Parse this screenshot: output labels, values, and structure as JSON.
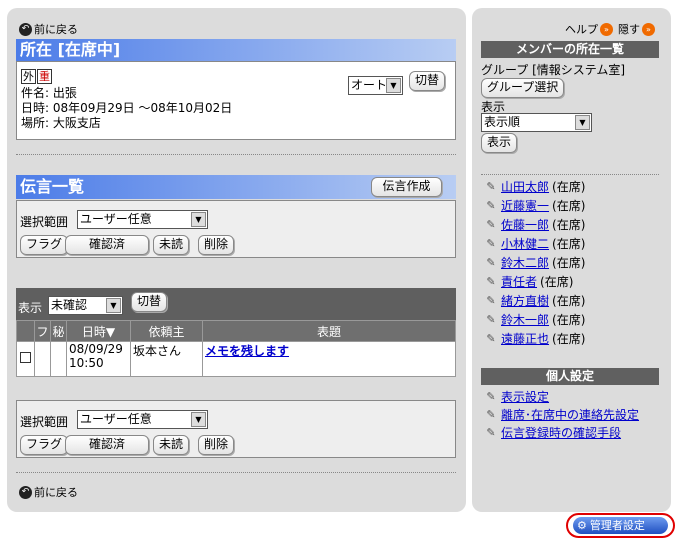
{
  "back_link": "前に戻る",
  "status": {
    "title": "所在 [在席中]",
    "tag_out": "外",
    "tag_heavy": "重",
    "mode_select": "オート",
    "switch_button": "切替",
    "subject": "件名: 出張",
    "datetime": "日時: 08年09月29日 ～08年10月02日",
    "place": "場所: 大阪支店"
  },
  "messages": {
    "title": "伝言一覧",
    "create_button": "伝言作成",
    "range_label": "選択範囲",
    "range_value": "ユーザー任意",
    "flag_button": "フラグ",
    "confirmed_button": "確認済",
    "unread_button": "未読",
    "delete_button": "削除"
  },
  "filter": {
    "label": "表示",
    "value": "未確認",
    "switch_button": "切替"
  },
  "table": {
    "headers": [
      "フ",
      "秘",
      "日時▼",
      "依頼主",
      "表題"
    ],
    "rows": [
      {
        "date": "08/09/29",
        "time": "10:50",
        "requester": "坂本さん",
        "title": "メモを残します"
      }
    ]
  },
  "bottom": {
    "range_label": "選択範囲",
    "range_value": "ユーザー任意",
    "flag_button": "フラグ",
    "confirmed_button": "確認済",
    "unread_button": "未読",
    "delete_button": "削除"
  },
  "side": {
    "help": "ヘルプ",
    "hide": "隠す",
    "members_title": "メンバーの所在一覧",
    "group_label": "グループ [情報システム室]",
    "group_button": "グループ選択",
    "display_label": "表示",
    "display_value": "表示順",
    "display_button": "表示",
    "members": [
      {
        "name": "山田太郎",
        "status": "(在席)"
      },
      {
        "name": "近藤憲一",
        "status": "(在席)"
      },
      {
        "name": "佐藤一郎",
        "status": "(在席)"
      },
      {
        "name": "小林健二",
        "status": "(在席)"
      },
      {
        "name": "鈴木二郎",
        "status": "(在席)"
      },
      {
        "name": "責任者",
        "status": "(在席)"
      },
      {
        "name": "緒方直樹",
        "status": "(在席)"
      },
      {
        "name": "鈴木一郎",
        "status": "(在席)"
      },
      {
        "name": "遠藤正也",
        "status": "(在席)"
      }
    ],
    "personal_title": "個人設定",
    "personal_links": [
      "表示設定",
      "離席･在席中の連絡先設定",
      "伝言登録時の確認手段"
    ]
  },
  "admin_button": "管理者設定",
  "colors": {
    "panel": "#dcdcdc",
    "header_blue": "#4c7ce8",
    "side_header": "#606060",
    "link": "#0000cc",
    "admin": "#2a5fd0",
    "highlight": "#e00000"
  }
}
